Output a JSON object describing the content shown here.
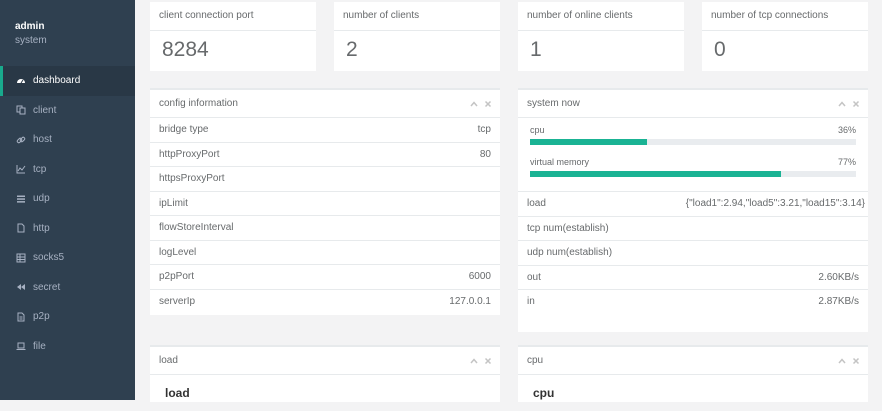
{
  "user": {
    "name": "admin",
    "role": "system"
  },
  "nav": [
    {
      "label": "dashboard",
      "icon": "dashboard-icon",
      "active": true
    },
    {
      "label": "client",
      "icon": "copy-icon"
    },
    {
      "label": "host",
      "icon": "link-icon"
    },
    {
      "label": "tcp",
      "icon": "line-chart-icon"
    },
    {
      "label": "udp",
      "icon": "list-icon"
    },
    {
      "label": "http",
      "icon": "file-icon"
    },
    {
      "label": "socks5",
      "icon": "table-icon"
    },
    {
      "label": "secret",
      "icon": "backward-icon"
    },
    {
      "label": "p2p",
      "icon": "file-text-icon"
    },
    {
      "label": "file",
      "icon": "laptop-icon"
    }
  ],
  "stats": [
    {
      "title": "client connection port",
      "value": "8284"
    },
    {
      "title": "number of clients",
      "value": "2"
    },
    {
      "title": "number of online clients",
      "value": "1"
    },
    {
      "title": "number of tcp connections",
      "value": "0"
    }
  ],
  "config": {
    "title": "config information",
    "rows": [
      {
        "key": "bridge type",
        "value": "tcp"
      },
      {
        "key": "httpProxyPort",
        "value": "80"
      },
      {
        "key": "httpsProxyPort",
        "value": ""
      },
      {
        "key": "ipLimit",
        "value": ""
      },
      {
        "key": "flowStoreInterval",
        "value": ""
      },
      {
        "key": "logLevel",
        "value": ""
      },
      {
        "key": "p2pPort",
        "value": "6000"
      },
      {
        "key": "serverIp",
        "value": "127.0.0.1"
      }
    ]
  },
  "system": {
    "title": "system now",
    "progress": [
      {
        "label": "cpu",
        "percent_text": "36%",
        "value": 36
      },
      {
        "label": "virtual memory",
        "percent_text": "77%",
        "value": 77
      }
    ],
    "rows": [
      {
        "key": "load",
        "value": "{\"load1\":2.94,\"load5\":3.21,\"load15\":3.14}"
      },
      {
        "key": "tcp num(establish)",
        "value": ""
      },
      {
        "key": "udp num(establish)",
        "value": ""
      },
      {
        "key": "out",
        "value": "2.60KB/s"
      },
      {
        "key": "in",
        "value": "2.87KB/s"
      }
    ]
  },
  "load_box": {
    "title": "load",
    "heading": "load"
  },
  "cpu_box": {
    "title": "cpu",
    "heading": "cpu"
  },
  "colors": {
    "sidebar": "#2f4050",
    "accent": "#1ab394",
    "background": "#f3f3f4"
  }
}
